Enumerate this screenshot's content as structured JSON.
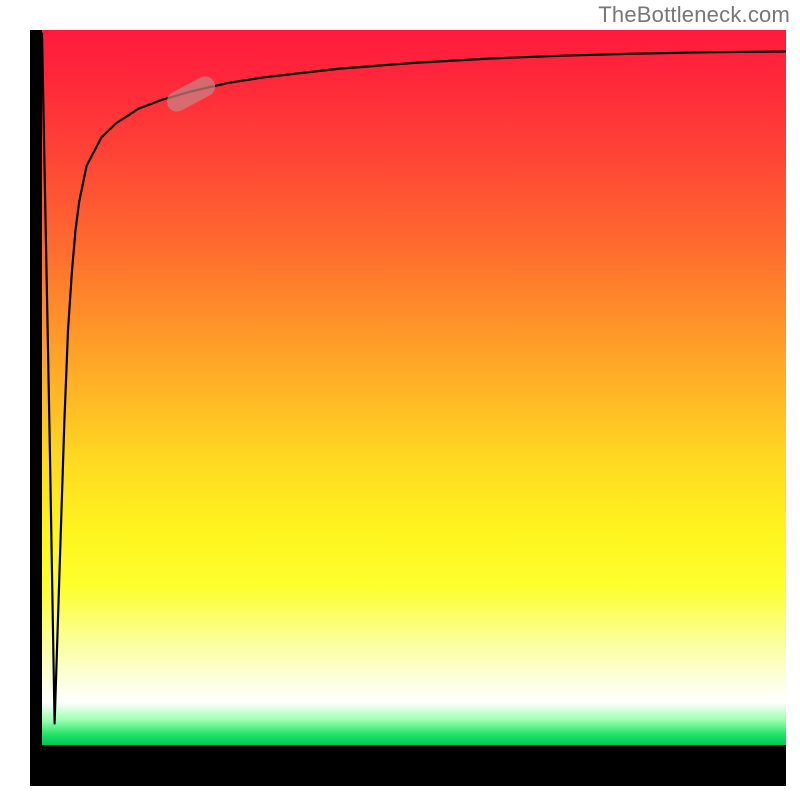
{
  "watermark": "TheBottleneck.com",
  "chart_data": {
    "type": "line",
    "title": "",
    "xlabel": "",
    "ylabel": "",
    "xlim": [
      0,
      100
    ],
    "ylim": [
      0,
      100
    ],
    "grid": false,
    "legend": false,
    "background": {
      "kind": "vertical-gradient",
      "stops": [
        {
          "pct": 0,
          "color": "#ff1a3e",
          "meaning": "high"
        },
        {
          "pct": 50,
          "color": "#ffb326",
          "meaning": "mid"
        },
        {
          "pct": 80,
          "color": "#fff41e",
          "meaning": "low-mid"
        },
        {
          "pct": 100,
          "color": "#00c853",
          "meaning": "optimal"
        }
      ]
    },
    "series": [
      {
        "name": "bottleneck-curve",
        "x": [
          0.0,
          1.0,
          1.7,
          3.0,
          3.5,
          4.0,
          4.5,
          5.0,
          6.0,
          8.0,
          10.0,
          13.0,
          16.0,
          20.0,
          25.0,
          30.0,
          40.0,
          50.0,
          60.0,
          70.0,
          80.0,
          90.0,
          100.0
        ],
        "y": [
          99.5,
          45.0,
          3.0,
          45.0,
          58.0,
          66.0,
          72.0,
          76.0,
          81.0,
          85.0,
          87.0,
          89.0,
          90.2,
          91.4,
          92.6,
          93.4,
          94.6,
          95.4,
          96.0,
          96.4,
          96.7,
          96.9,
          97.0
        ]
      }
    ],
    "marker": {
      "name": "highlight-segment",
      "approx_x": 20,
      "approx_y": 91,
      "rotation_deg": -28
    }
  }
}
